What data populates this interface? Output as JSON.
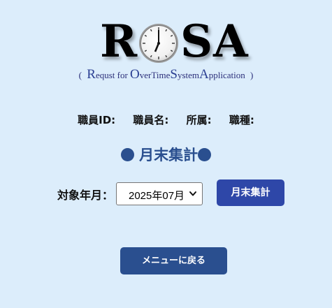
{
  "logo": {
    "letter_r": "R",
    "letter_s": "S",
    "letter_a": "A",
    "subtitle": {
      "open_paren": "(",
      "r_cap": "R",
      "r_rest": "equst for ",
      "o_cap": "O",
      "o_rest": "verTime",
      "s_cap": "S",
      "s_rest": "ystem",
      "a_cap": "A",
      "a_rest": "pplication",
      "close_paren": ")"
    }
  },
  "employee_info": {
    "id_label": "職員ID:",
    "name_label": "職員名:",
    "dept_label": "所属:",
    "job_label": "職種:"
  },
  "heading": {
    "title": "月末集計"
  },
  "form": {
    "month_label": "対象年月：",
    "month_value": "2025年07月",
    "aggregate_button": "月末集計"
  },
  "back_button": "メニューに戻る",
  "colors": {
    "background": "#dcedfb",
    "heading": "#2a4f8f",
    "aggregate_button": "#2e47a8",
    "back_button": "#2a4f8f"
  },
  "icons": {
    "logo_o": "clock-icon",
    "select_arrow": "chevron-down-icon",
    "heading_marker": "bullet-dot"
  }
}
